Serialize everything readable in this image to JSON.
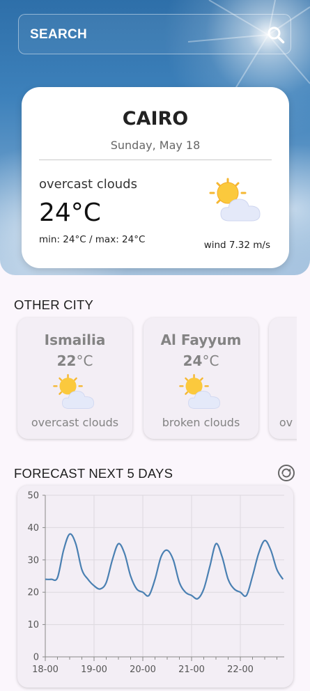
{
  "search": {
    "placeholder": "SEARCH"
  },
  "current": {
    "city": "CAIRO",
    "date": "Sunday, May 18",
    "description": "overcast clouds",
    "temperature": "24°C",
    "minmax": "min: 24°C / max: 24°C",
    "wind": "wind 7.32 m/s",
    "icon": "partly-cloudy-icon"
  },
  "other_city": {
    "title": "OTHER CITY",
    "cities": [
      {
        "name": "Ismailia",
        "temp": "22",
        "unit": "°C",
        "description": "overcast clouds",
        "icon": "partly-cloudy-icon"
      },
      {
        "name": "Al Fayyum",
        "temp": "24",
        "unit": "°C",
        "description": "broken clouds",
        "icon": "partly-cloudy-icon"
      },
      {
        "name": "",
        "temp": "",
        "unit": "",
        "description": "ov",
        "icon": "partly-cloudy-icon"
      }
    ]
  },
  "forecast": {
    "title": "FORECAST NEXT 5 DAYS",
    "refresh_icon": "refresh-icon"
  },
  "chart_data": {
    "type": "line",
    "title": "",
    "xlabel": "",
    "ylabel": "",
    "xlim": [
      0,
      4.9
    ],
    "ylim": [
      0,
      50
    ],
    "yticks": [
      0,
      10,
      20,
      30,
      40,
      50
    ],
    "xticks": [
      0,
      1,
      2,
      3,
      4
    ],
    "xtick_labels": [
      "18-00",
      "19-00",
      "20-00",
      "21-00",
      "22-00"
    ],
    "grid": true,
    "line_color": "#4a80b2",
    "series": [
      {
        "name": "",
        "x": [
          0,
          0.125,
          0.25,
          0.375,
          0.5,
          0.625,
          0.75,
          0.875,
          1.0,
          1.125,
          1.25,
          1.375,
          1.5,
          1.625,
          1.75,
          1.875,
          2.0,
          2.125,
          2.25,
          2.375,
          2.5,
          2.625,
          2.75,
          2.875,
          3.0,
          3.125,
          3.25,
          3.375,
          3.5,
          3.625,
          3.75,
          3.875,
          4.0,
          4.125,
          4.25,
          4.375,
          4.5,
          4.625,
          4.75,
          4.875
        ],
        "values": [
          24,
          24,
          24.5,
          33,
          38,
          35,
          27,
          24,
          22,
          21,
          23,
          30,
          35,
          32,
          25,
          21,
          20,
          19,
          24,
          31,
          33,
          30,
          23,
          20,
          19,
          18,
          21,
          28,
          35,
          31,
          24,
          21,
          20,
          19,
          25,
          32,
          36,
          33,
          27,
          24
        ]
      }
    ]
  }
}
